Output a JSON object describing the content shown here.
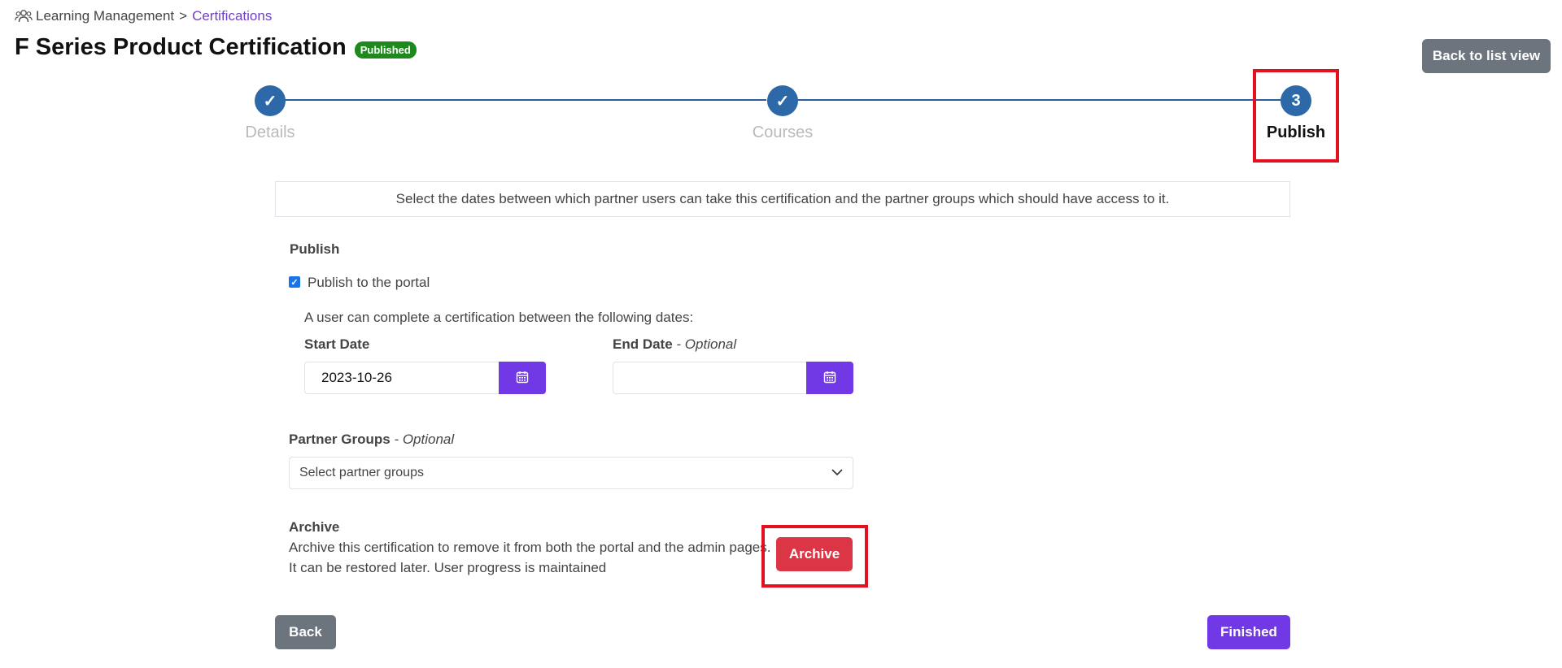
{
  "breadcrumb": {
    "icon": "people-icon",
    "root": "Learning Management",
    "separator": ">",
    "current": "Certifications"
  },
  "page": {
    "title": "F Series Product Certification",
    "status_badge": "Published",
    "back_to_list_label": "Back to list view"
  },
  "stepper": {
    "steps": [
      {
        "label": "Details",
        "state": "complete",
        "marker": "✓"
      },
      {
        "label": "Courses",
        "state": "complete",
        "marker": "✓"
      },
      {
        "label": "Publish",
        "state": "active",
        "marker": "3"
      }
    ]
  },
  "info_text": "Select the dates between which partner users can take this certification and the partner groups which should have access to it.",
  "publish": {
    "heading": "Publish",
    "checkbox_label": "Publish to the portal",
    "checked": true,
    "date_intro": "A user can complete a certification between the following dates:",
    "start_date": {
      "label": "Start Date",
      "value": "2023-10-26"
    },
    "end_date": {
      "label": "End Date",
      "optional_suffix": "- Optional",
      "value": ""
    }
  },
  "partner_groups": {
    "label": "Partner Groups",
    "optional_suffix": "- Optional",
    "placeholder": "Select partner groups"
  },
  "archive": {
    "heading": "Archive",
    "description_line1": "Archive this certification to remove it from both the portal and the admin pages.",
    "description_line2": "It can be restored later. User progress is maintained",
    "button_label": "Archive"
  },
  "footer": {
    "back_label": "Back",
    "finished_label": "Finished"
  },
  "colors": {
    "accent": "#7138e6",
    "step": "#2d69a8",
    "danger": "#dc3545",
    "published_badge": "#1e8a1e",
    "highlight": "#e3111f"
  }
}
